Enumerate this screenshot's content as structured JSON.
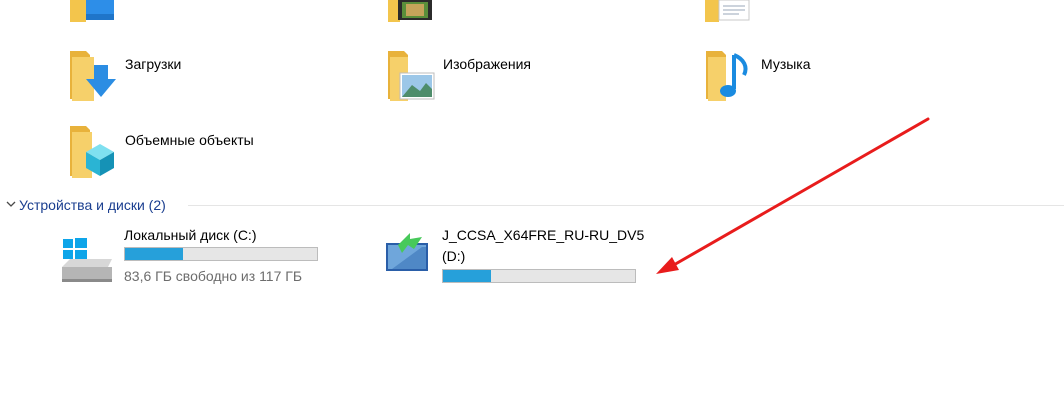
{
  "folders": [
    {
      "label": "Загрузки",
      "icon": "downloads-folder-icon"
    },
    {
      "label": "Изображения",
      "icon": "pictures-folder-icon"
    },
    {
      "label": "Музыка",
      "icon": "music-folder-icon"
    },
    {
      "label": "Объемные объекты",
      "icon": "3d-objects-folder-icon"
    }
  ],
  "devices_group": {
    "label": "Устройства и диски (2)"
  },
  "drives": [
    {
      "name": "Локальный диск (C:)",
      "free_text": "83,6 ГБ свободно из 117 ГБ",
      "used_fraction": 0.3,
      "icon": "windows-drive-icon"
    },
    {
      "name_line1": "J_CCSA_X64FRE_RU-RU_DV5",
      "name_line2": "(D:)",
      "used_fraction": 0.25,
      "icon": "dvd-drive-icon"
    }
  ],
  "colors": {
    "accent_bar": "#26a0da",
    "annotation_arrow": "#e81c1c",
    "group_header": "#1a3e8f"
  }
}
